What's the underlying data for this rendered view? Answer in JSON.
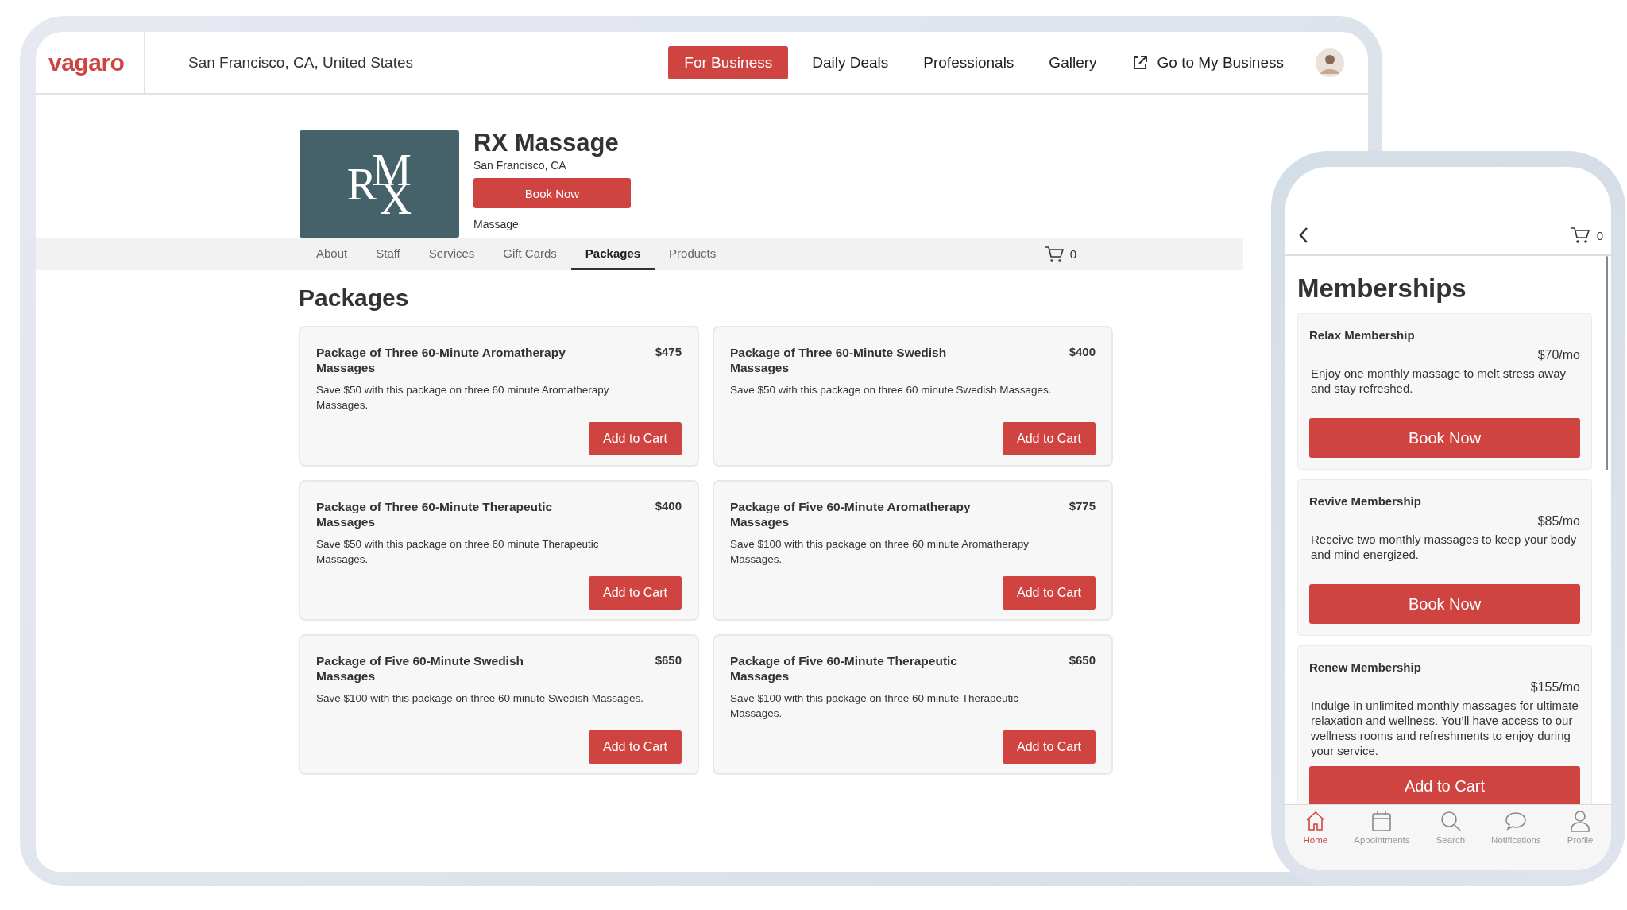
{
  "top_nav": {
    "brand": "vagaro",
    "location": "San Francisco, CA, United States",
    "links": [
      {
        "label": "For Business",
        "kind": "primary"
      },
      {
        "label": "Daily Deals",
        "kind": "plain"
      },
      {
        "label": "Professionals",
        "kind": "plain"
      },
      {
        "label": "Gallery",
        "kind": "plain"
      },
      {
        "label": "Go to My Business",
        "kind": "external"
      }
    ]
  },
  "business": {
    "logo": "R$^{M}$$_{X}$",
    "name": "RX Massage",
    "location": "San Francisco, CA",
    "book_button": "Book Now",
    "category": "Massage"
  },
  "tabs": [
    {
      "label": "About",
      "selected": false
    },
    {
      "label": "Staff",
      "selected": false
    },
    {
      "label": "Services",
      "selected": false
    },
    {
      "label": "Gift Cards",
      "selected": false
    },
    {
      "label": "Packages",
      "selected": true
    },
    {
      "label": "Products",
      "selected": false
    }
  ],
  "cart_count": "0",
  "packages": {
    "title": "Packages",
    "items": [
      {
        "name": "Package of Three 60-Minute Aromatherapy Massages",
        "price": "$475",
        "description": "Save $50 with this package on three 60 minute Aromatherapy Massages.",
        "button": "Add to Cart"
      },
      {
        "name": "Package of Three 60-Minute Swedish Massages",
        "price": "$400",
        "description": "Save $50 with this package on three 60 minute Swedish Massages.",
        "button": "Add to Cart"
      },
      {
        "name": "Package of Three 60-Minute Therapeutic Massages",
        "price": "$400",
        "description": "Save $50 with this package on three 60 minute Therapeutic Massages.",
        "button": "Add to Cart"
      },
      {
        "name": "Package of Five 60-Minute Aromatherapy Massages",
        "price": "$775",
        "description": "Save $100 with this package on three 60 minute Aromatherapy Massages.",
        "button": "Add to Cart"
      },
      {
        "name": "Package of Five 60-Minute Swedish Massages",
        "price": "$650",
        "description": "Save $100 with this package on three 60 minute Swedish Massages.",
        "button": "Add to Cart"
      },
      {
        "name": "Package of Five 60-Minute Therapeutic Massages",
        "price": "$650",
        "description": "Save $100 with this package on three 60 minute Therapeutic Massages.",
        "button": "Add to Cart"
      }
    ]
  },
  "phone": {
    "cart_count": "0",
    "title": "Memberships",
    "memberships": [
      {
        "name": "Relax Membership",
        "price": "$70/mo",
        "description": "Enjoy one monthly massage to melt stress away and stay refreshed.",
        "button": "Book Now"
      },
      {
        "name": "Revive Membership",
        "price": "$85/mo",
        "description": "Receive two monthly massages to keep your body and mind energized.",
        "button": "Book Now"
      },
      {
        "name": "Renew Membership",
        "price": "$155/mo",
        "description": "Indulge in unlimited monthly massages for ultimate relaxation and wellness. You’ll have access to our wellness rooms and refreshments to enjoy during your service.",
        "button": "Add to Cart"
      }
    ],
    "tab_bar": [
      {
        "label": "Home",
        "kind": "home",
        "selected": true
      },
      {
        "label": "Appointments",
        "kind": "calendar",
        "selected": false
      },
      {
        "label": "Search",
        "kind": "search",
        "selected": false
      },
      {
        "label": "Notifications",
        "kind": "chat",
        "selected": false
      },
      {
        "label": "Profile",
        "kind": "person",
        "selected": false
      }
    ]
  }
}
